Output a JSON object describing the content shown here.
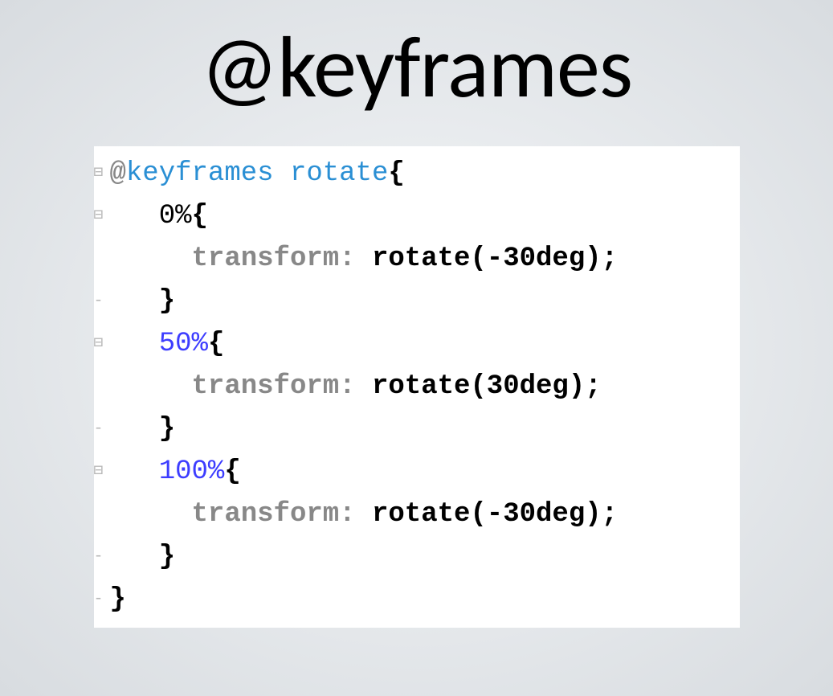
{
  "title": "@keyframes",
  "code": {
    "at": "@",
    "rule": "keyframes",
    "name": "rotate",
    "open_brace": "{",
    "close_brace": "}",
    "lines": [
      {
        "gutter": "⊟",
        "pct_class": "",
        "pct": "",
        "content_type": "head"
      },
      {
        "gutter": "⊟",
        "pct_class": "pct0",
        "pct": "0%",
        "content_type": "pct_open"
      },
      {
        "gutter": "",
        "prop": "transform",
        "val": "rotate(-30deg)",
        "content_type": "decl"
      },
      {
        "gutter": "-",
        "content_type": "close"
      },
      {
        "gutter": "⊟",
        "pct_class": "pct",
        "pct": "50%",
        "content_type": "pct_open"
      },
      {
        "gutter": "",
        "prop": "transform",
        "val": "rotate(30deg)",
        "content_type": "decl"
      },
      {
        "gutter": "-",
        "content_type": "close"
      },
      {
        "gutter": "⊟",
        "pct_class": "pct",
        "pct": "100%",
        "content_type": "pct_open"
      },
      {
        "gutter": "",
        "prop": "transform",
        "val": "rotate(-30deg)",
        "content_type": "decl"
      },
      {
        "gutter": "-",
        "content_type": "close"
      },
      {
        "gutter": "-",
        "content_type": "close"
      }
    ]
  }
}
